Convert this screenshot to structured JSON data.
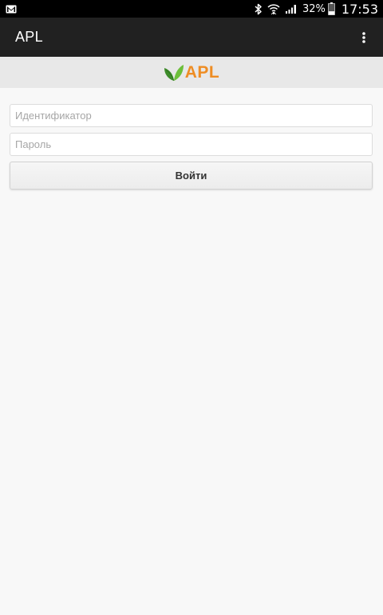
{
  "status_bar": {
    "battery_percent": "32%",
    "time": "17:53",
    "icons": [
      "gmail-icon",
      "bluetooth-icon",
      "wifi-icon",
      "signal-icon",
      "battery-icon"
    ],
    "battery_level": 0.32
  },
  "action_bar": {
    "title": "APL",
    "overflow_icon": "more-vert-icon"
  },
  "header": {
    "logo_text": "APL",
    "logo_icon": "leaf-icon",
    "logo_color": "#ee8d24",
    "leaf_colors": [
      "#3d8c2a",
      "#6cbf3a"
    ]
  },
  "login_form": {
    "identifier_placeholder": "Идентификатор",
    "identifier_value": "",
    "password_placeholder": "Пароль",
    "password_value": "",
    "submit_label": "Войти"
  },
  "colors": {
    "status_bar": "#000000",
    "action_bar": "#212121",
    "header_bg": "#e8e8e8",
    "page_bg": "#f8f8f8"
  }
}
